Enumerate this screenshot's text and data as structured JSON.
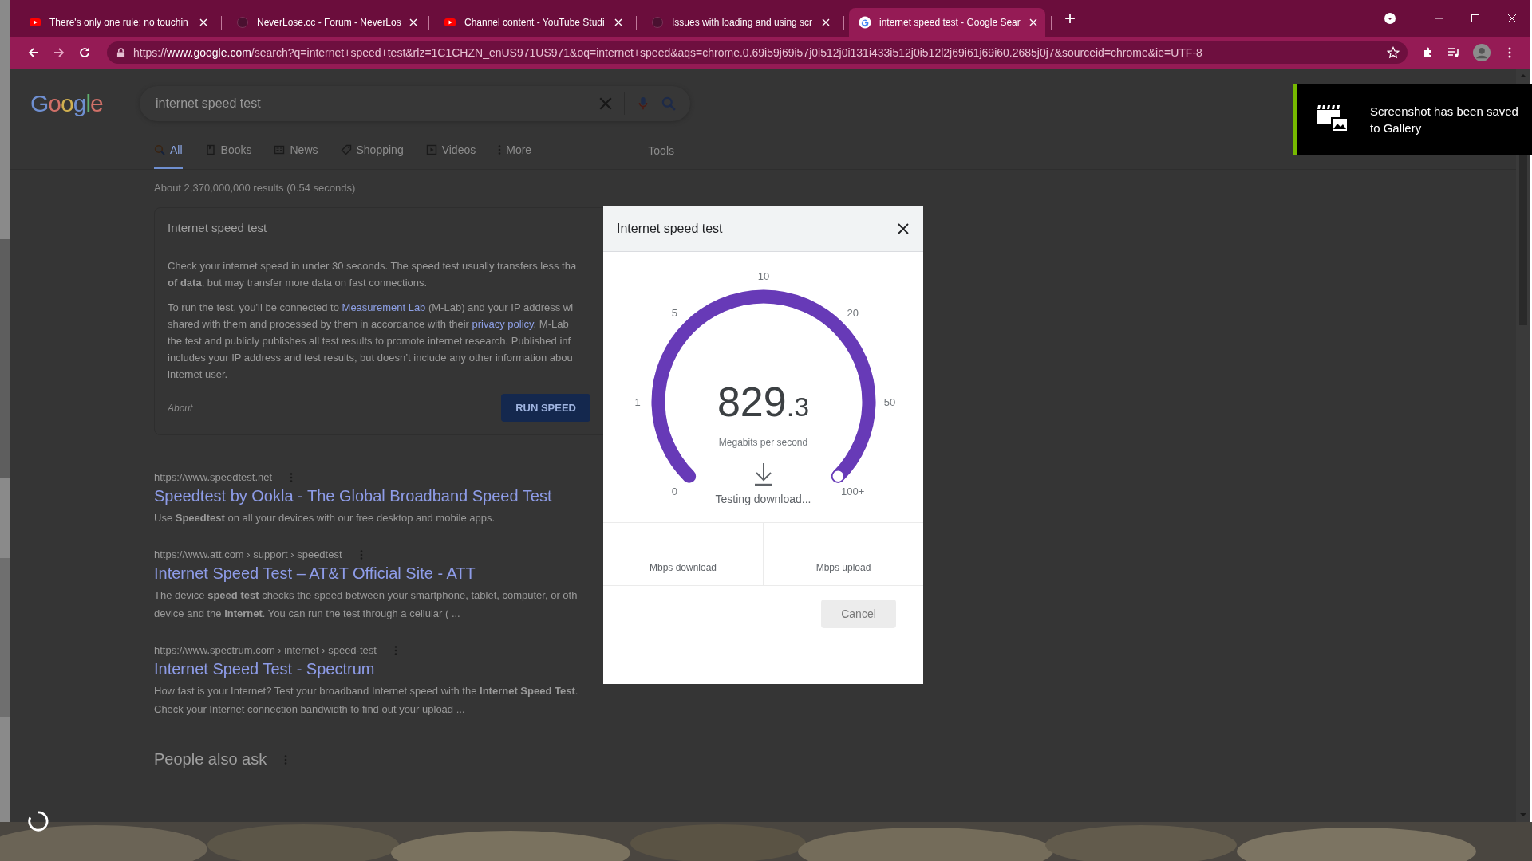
{
  "browser": {
    "tabs": [
      {
        "title": "There's only one rule: no touchin",
        "kind": "video",
        "selected": false
      },
      {
        "title": "NeverLose.cc - Forum - NeverLos",
        "kind": "site",
        "selected": false
      },
      {
        "title": "Channel content - YouTube Studi",
        "kind": "video",
        "selected": false
      },
      {
        "title": "Issues with loading and using scr",
        "kind": "site",
        "selected": false
      },
      {
        "title": "internet speed test - Google Sear",
        "kind": "search",
        "selected": true
      }
    ],
    "new_tab": "+",
    "url": {
      "scheme": "https://",
      "host": "www.google.com",
      "rest": "/search?q=internet+speed+test&rlz=1C1CHZN_enUS971US971&oq=internet+speed&aqs=chrome.0.69i59j69i57j0i512j0i131i433i512j0i512l2j69i61j69i60.2685j0j7&sourceid=chrome&ie=UTF-8"
    }
  },
  "google": {
    "logo": "Google",
    "query": "internet speed test",
    "nav": [
      {
        "label": "All",
        "kind": "web",
        "selected": true
      },
      {
        "label": "Books",
        "kind": "books",
        "selected": false
      },
      {
        "label": "News",
        "kind": "news",
        "selected": false
      },
      {
        "label": "Shopping",
        "kind": "shopping",
        "selected": false
      },
      {
        "label": "Videos",
        "kind": "videos",
        "selected": false
      },
      {
        "label": "More",
        "kind": "more",
        "selected": false
      }
    ],
    "tools": "Tools",
    "stats": "About 2,370,000,000 results (0.54 seconds)",
    "card": {
      "title": "Internet speed test",
      "paragraphs": [
        {
          "lines": [
            [
              {
                "kind": "text",
                "text": "Check your internet speed in under 30 seconds. The speed test usually transfers less tha"
              }
            ],
            [
              {
                "kind": "text",
                "text": "**of data**, but may transfer more data on fast connections."
              }
            ]
          ]
        },
        {
          "lines": [
            [
              {
                "kind": "text",
                "text": "To run the test, you'll be connected to "
              },
              {
                "kind": "link",
                "text": "Measurement Lab"
              },
              {
                "kind": "text",
                "text": " (M-Lab) and your IP address wi"
              }
            ],
            [
              {
                "kind": "text",
                "text": "shared with them and processed by them in accordance with their "
              },
              {
                "kind": "link",
                "text": "privacy policy"
              },
              {
                "kind": "text",
                "text": ". M-Lab"
              }
            ],
            [
              {
                "kind": "text",
                "text": "the test and publicly publishes all test results to promote internet research. Published inf"
              }
            ],
            [
              {
                "kind": "text",
                "text": "includes your IP address and test results, but doesn’t include any other information abou"
              }
            ],
            [
              {
                "kind": "text",
                "text": "internet user."
              }
            ]
          ]
        }
      ],
      "about": "About",
      "button": "RUN SPEED"
    },
    "results": [
      {
        "url": "https://www.speedtest.net",
        "title": "Speedtest by Ookla - The Global Broadband Speed Test",
        "snippet": [
          "Use **Speedtest** on all your devices with our free desktop and mobile apps."
        ]
      },
      {
        "url": "https://www.att.com › support › speedtest",
        "title": "Internet Speed Test – AT&T Official Site - ATT",
        "snippet": [
          "The device **speed test** checks the speed between your smartphone, tablet, computer, or oth",
          "device and the **internet**. You can run the test through a cellular ( ..."
        ]
      },
      {
        "url": "https://www.spectrum.com › internet › speed-test",
        "title": "Internet Speed Test - Spectrum",
        "snippet": [
          "How fast is your Internet? Test your broadband Internet speed with the **Internet Speed Test**.",
          "Check your Internet connection bandwidth to find out your upload ..."
        ]
      }
    ],
    "people_also_ask": "People also ask"
  },
  "dialog": {
    "title": "Internet speed test",
    "gauge": {
      "ticks": [
        "0",
        "1",
        "5",
        "10",
        "20",
        "50",
        "100+"
      ],
      "level": 1,
      "reading_whole": "829",
      "reading_fraction": ".3",
      "unit": "Megabits per second",
      "status": "Testing download..."
    },
    "stats": [
      "Mbps download",
      "Mbps upload"
    ],
    "cancel": "Cancel"
  },
  "notification": {
    "text": "Screenshot has been saved to Gallery"
  }
}
